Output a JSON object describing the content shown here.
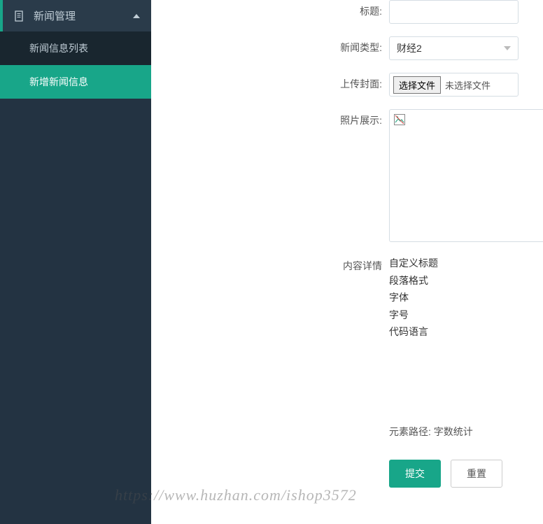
{
  "sidebar": {
    "header_label": "新闻管理",
    "items": [
      {
        "label": "新闻信息列表"
      },
      {
        "label": "新增新闻信息"
      }
    ]
  },
  "form": {
    "title_label": "标题",
    "title_value": "",
    "category_label": "新闻类型",
    "category_value": "财经2",
    "cover_label": "上传封面",
    "file_button": "选择文件",
    "file_status": "未选择文件",
    "preview_label": "照片展示",
    "content_label": "内容详情",
    "editor_options": [
      "自定义标题",
      "段落格式",
      "字体",
      "字号",
      "代码语言"
    ],
    "editor_footer": "元素路径: 字数统计",
    "submit_label": "提交",
    "reset_label": "重置"
  },
  "watermark": "https://www.huzhan.com/ishop3572"
}
